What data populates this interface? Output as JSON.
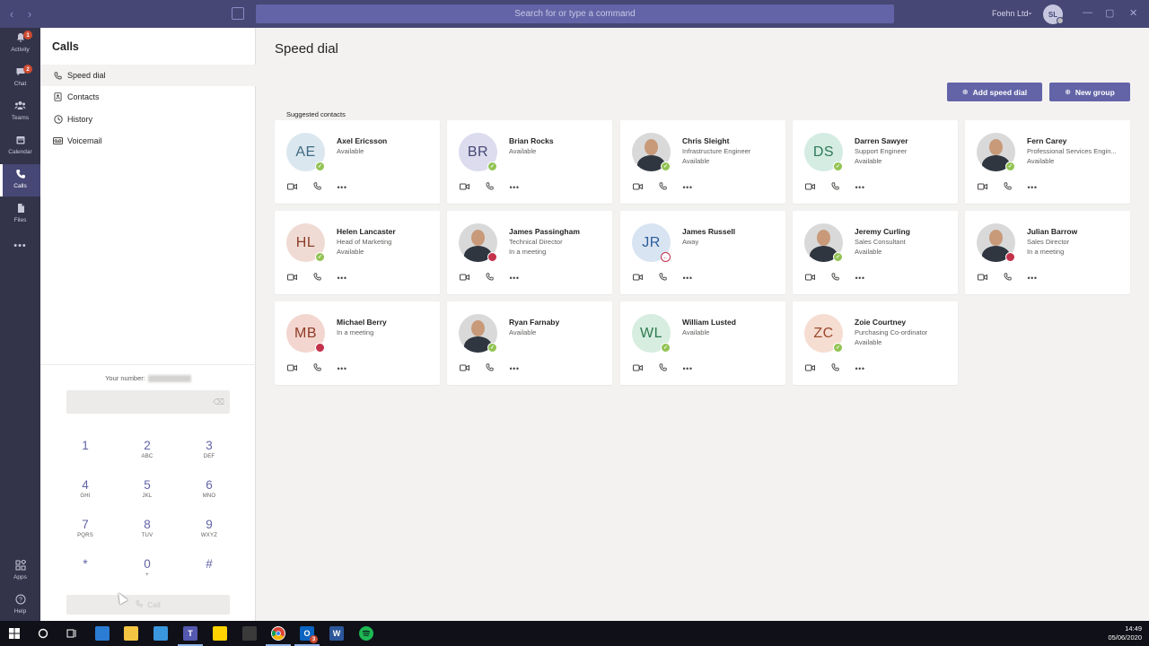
{
  "titlebar": {
    "search_placeholder": "Search for or type a command",
    "tenant": "Foehn Ltd",
    "tenant_chevron": "⌄",
    "user_initials": "SL"
  },
  "appbar": {
    "items": [
      {
        "label": "Activity",
        "icon": "bell-icon",
        "badge": "1"
      },
      {
        "label": "Chat",
        "icon": "chat-icon",
        "badge": "2"
      },
      {
        "label": "Teams",
        "icon": "teams-icon"
      },
      {
        "label": "Calendar",
        "icon": "calendar-icon"
      },
      {
        "label": "Calls",
        "icon": "phone-icon",
        "active": true
      },
      {
        "label": "Files",
        "icon": "files-icon"
      },
      {
        "label": "",
        "icon": "more-icon"
      }
    ],
    "bottom": [
      {
        "label": "Apps",
        "icon": "apps-icon"
      },
      {
        "label": "Help",
        "icon": "help-icon"
      }
    ]
  },
  "leftpanel": {
    "title": "Calls",
    "nav": [
      {
        "label": "Speed dial",
        "icon": "phone-icon",
        "active": true
      },
      {
        "label": "Contacts",
        "icon": "contacts-icon"
      },
      {
        "label": "History",
        "icon": "history-icon"
      },
      {
        "label": "Voicemail",
        "icon": "voicemail-icon"
      }
    ],
    "your_number_label": "Your number:",
    "keys": [
      {
        "digit": "1",
        "letters": ""
      },
      {
        "digit": "2",
        "letters": "ABC"
      },
      {
        "digit": "3",
        "letters": "DEF"
      },
      {
        "digit": "4",
        "letters": "GHI"
      },
      {
        "digit": "5",
        "letters": "JKL"
      },
      {
        "digit": "6",
        "letters": "MNO"
      },
      {
        "digit": "7",
        "letters": "PQRS"
      },
      {
        "digit": "8",
        "letters": "TUV"
      },
      {
        "digit": "9",
        "letters": "WXYZ"
      },
      {
        "digit": "*",
        "letters": ""
      },
      {
        "digit": "0",
        "letters": "+"
      },
      {
        "digit": "#",
        "letters": ""
      }
    ],
    "call_label": "Call"
  },
  "main": {
    "title": "Speed dial",
    "add_speed_dial": "Add speed dial",
    "new_group": "New group",
    "suggested_label": "Suggested contacts",
    "contacts": [
      {
        "name": "Axel Ericsson",
        "initials": "AE",
        "bg": "#dbe7ef",
        "fg": "#3e6a82",
        "title": "",
        "presence": "Available",
        "status": "available"
      },
      {
        "name": "Brian Rocks",
        "initials": "BR",
        "bg": "#dcdcee",
        "fg": "#464775",
        "title": "",
        "presence": "Available",
        "status": "available"
      },
      {
        "name": "Chris Sleight",
        "initials": "",
        "bg": "",
        "fg": "",
        "title": "Infrastructure Engineer",
        "presence": "Available",
        "status": "available"
      },
      {
        "name": "Darren Sawyer",
        "initials": "DS",
        "bg": "#d4ece2",
        "fg": "#2e7a59",
        "title": "Support Engineer",
        "presence": "Available",
        "status": "available"
      },
      {
        "name": "Fern Carey",
        "initials": "",
        "bg": "",
        "fg": "",
        "title": "Professional Services Engin...",
        "presence": "Available",
        "status": "available"
      },
      {
        "name": "Helen Lancaster",
        "initials": "HL",
        "bg": "#f0dbd4",
        "fg": "#8c3e2a",
        "title": "Head of Marketing",
        "presence": "Available",
        "status": "available"
      },
      {
        "name": "James Passingham",
        "initials": "",
        "bg": "",
        "fg": "",
        "title": "Technical Director",
        "presence": "In a meeting",
        "status": "busy"
      },
      {
        "name": "James Russell",
        "initials": "JR",
        "bg": "#d9e4f2",
        "fg": "#2b5d9a",
        "title": "",
        "presence": "Away",
        "status": "away"
      },
      {
        "name": "Jeremy Curling",
        "initials": "",
        "bg": "",
        "fg": "",
        "title": "Sales Consultant",
        "presence": "Available",
        "status": "available"
      },
      {
        "name": "Julian Barrow",
        "initials": "",
        "bg": "",
        "fg": "",
        "title": "Sales Director",
        "presence": "In a meeting",
        "status": "busy"
      },
      {
        "name": "Michael Berry",
        "initials": "MB",
        "bg": "#f3d6cf",
        "fg": "#8e3a25",
        "title": "",
        "presence": "In a meeting",
        "status": "busy"
      },
      {
        "name": "Ryan Farnaby",
        "initials": "",
        "bg": "",
        "fg": "",
        "title": "",
        "presence": "Available",
        "status": "available"
      },
      {
        "name": "William Lusted",
        "initials": "WL",
        "bg": "#d6ede0",
        "fg": "#2f7a4e",
        "title": "",
        "presence": "Available",
        "status": "available"
      },
      {
        "name": "Zoie Courtney",
        "initials": "ZC",
        "bg": "#f6ddd2",
        "fg": "#9a4a2c",
        "title": "Purchasing Co-ordinator",
        "presence": "Available",
        "status": "available"
      }
    ]
  },
  "taskbar": {
    "time": "14:49",
    "date": "05/06/2020",
    "outlook_badge": "3"
  },
  "colors": {
    "brand": "#6264a7",
    "titlebar": "#464775",
    "appbar": "#33344a",
    "available": "#92c353",
    "busy": "#c4314b"
  }
}
